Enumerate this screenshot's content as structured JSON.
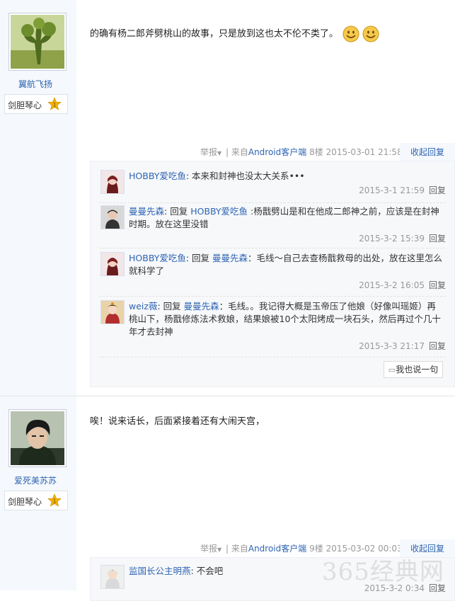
{
  "post1": {
    "author": "翼航飞扬",
    "badge": "剑胆琴心",
    "level": "1",
    "content": "的确有杨二郎斧劈桃山的故事，只是放到这也太不伦不类了。",
    "report": "举报",
    "tail_text": "| 来自",
    "client": "Android客户端",
    "floor": "8楼",
    "time": "2015-03-01 21:58",
    "collapse": "收起回复",
    "replies": [
      {
        "user": "HOBBY爱吃鱼",
        "prefix": "",
        "target": "",
        "text": "本来和封神也没太大关系•••",
        "time": "2015-3-1 21:59",
        "reply": "回复"
      },
      {
        "user": "曼曼先森",
        "prefix": "回复",
        "target": "HOBBY爱吃鱼",
        "text": ":杨戬劈山是和在他成二郎神之前，应该是在封神时期。放在这里没错",
        "time": "2015-3-2 15:39",
        "reply": "回复"
      },
      {
        "user": "HOBBY爱吃鱼",
        "prefix": "回复",
        "target": "曼曼先森",
        "text": "：毛线～自己去查杨戬救母的出处，放在这里怎么就科学了",
        "time": "2015-3-2 16:05",
        "reply": "回复"
      },
      {
        "user": "weiz薇",
        "prefix": "回复",
        "target": "曼曼先森",
        "text": "：毛线。。我记得大概是玉帝压了他娘（好像叫瑶姬）再桃山下，杨戬修炼法术救娘，结果娘被10个太阳烤成一块石头，然后再过个几十年才去封神",
        "time": "2015-3-3 21:17",
        "reply": "回复"
      }
    ],
    "say_button": "我也说一句"
  },
  "post2": {
    "author": "爱死美苏苏",
    "badge": "剑胆琴心",
    "level": "1",
    "content": "唉！说来话长，后面紧接着还有大闹天宫，",
    "report": "举报",
    "tail_text": "| 来自",
    "client": "Android客户端",
    "floor": "9楼",
    "time": "2015-03-02 00:03",
    "collapse": "收起回复",
    "replies": [
      {
        "user": "监国长公主明燕",
        "text": "不会吧",
        "time": "2015-3-2 0:34",
        "reply": "回复"
      }
    ]
  },
  "watermark": "365经典网",
  "colors": {
    "link": "#2d64b3",
    "sidebar": "#f5f8fc",
    "reply_bg": "#f7f8fa",
    "badge_star": "#f0b400"
  }
}
